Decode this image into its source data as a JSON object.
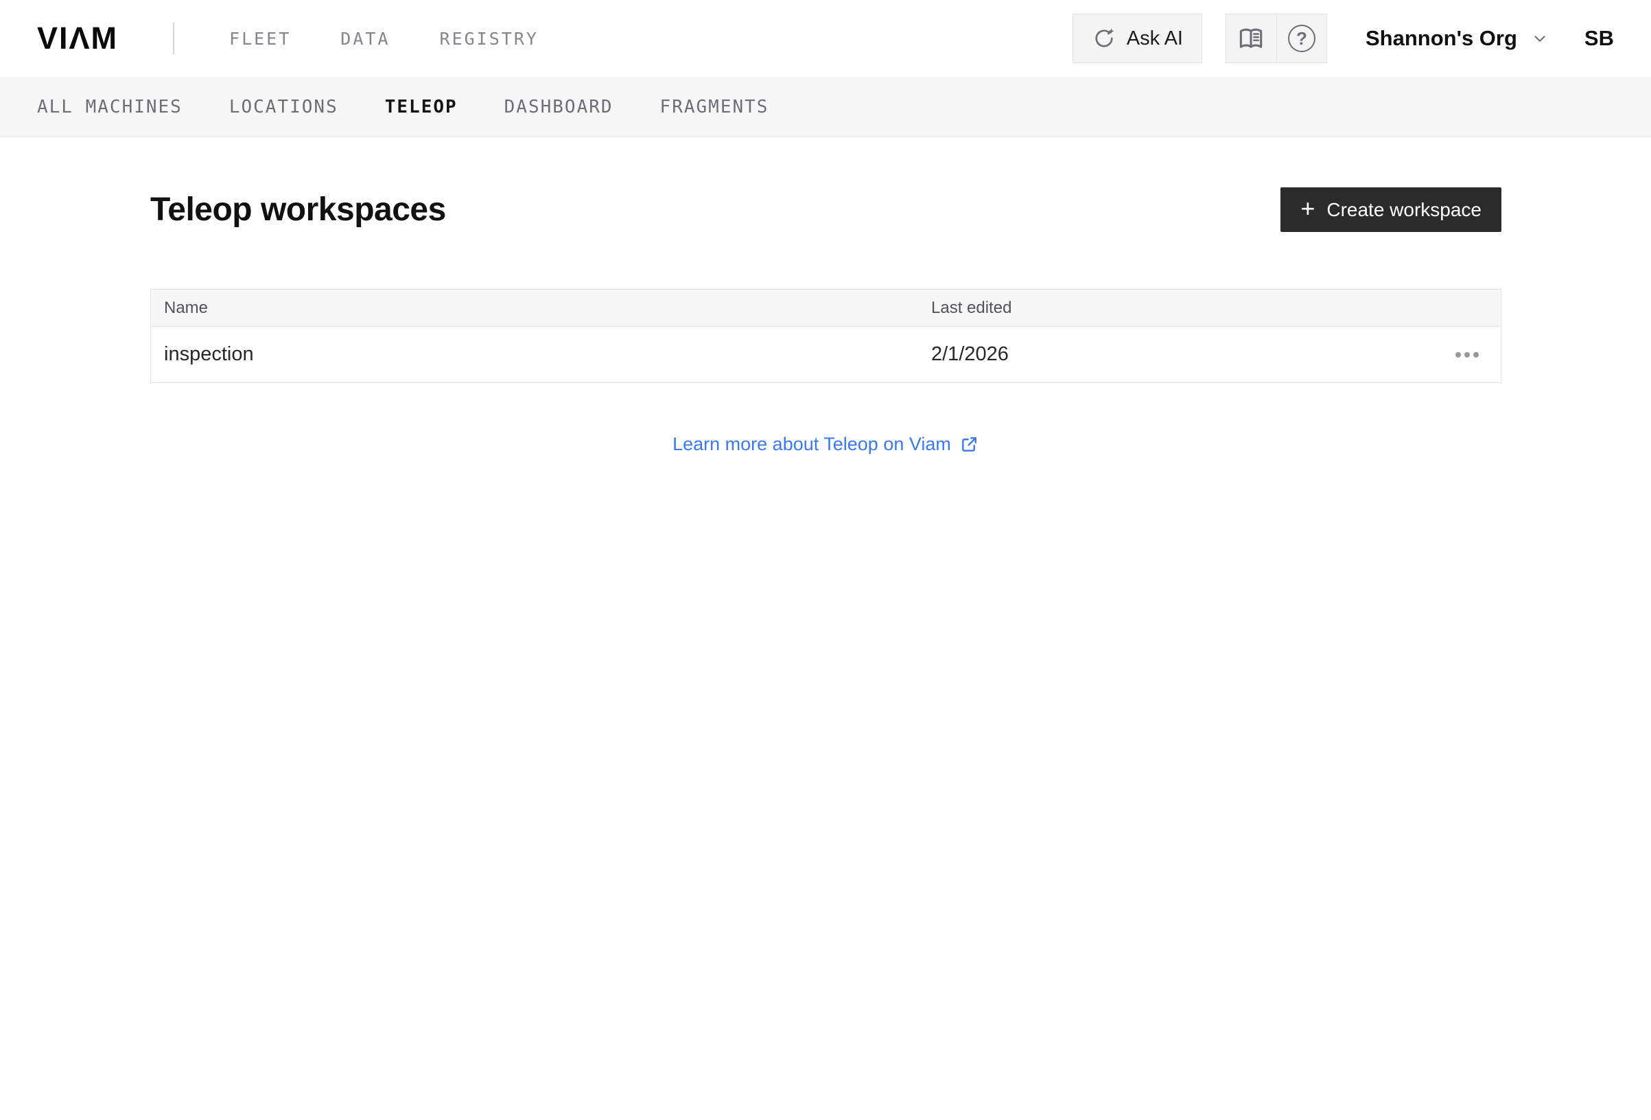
{
  "header": {
    "logo_text": "VIΛM",
    "nav": [
      {
        "label": "FLEET"
      },
      {
        "label": "DATA"
      },
      {
        "label": "REGISTRY"
      }
    ],
    "ask_ai_label": "Ask AI",
    "org_name": "Shannon's Org",
    "avatar_initials": "SB"
  },
  "subnav": {
    "items": [
      {
        "label": "ALL MACHINES",
        "active": false
      },
      {
        "label": "LOCATIONS",
        "active": false
      },
      {
        "label": "TELEOP",
        "active": true
      },
      {
        "label": "DASHBOARD",
        "active": false
      },
      {
        "label": "FRAGMENTS",
        "active": false
      }
    ]
  },
  "main": {
    "title": "Teleop workspaces",
    "create_button_label": "Create workspace",
    "table": {
      "columns": {
        "name": "Name",
        "last_edited": "Last edited"
      },
      "rows": [
        {
          "name": "inspection",
          "last_edited": "2/1/2026"
        }
      ]
    },
    "learn_more_label": "Learn more about Teleop on Viam"
  },
  "icons": {
    "plus": "+",
    "help": "?",
    "sparkle_refresh": "ask-ai sparkle circular-arrow",
    "book": "open-book docs",
    "chevron_down": "chevron-down",
    "ellipsis": "horizontal-dots menu",
    "external_link": "external-link arrow-out-of-box"
  },
  "colors": {
    "link_blue": "#3b79f2",
    "create_button_bg": "#2b2b2b",
    "subnav_bg": "#f7f7f8",
    "border_gray": "#e4e4e7",
    "nav_gray": "#85858c"
  }
}
